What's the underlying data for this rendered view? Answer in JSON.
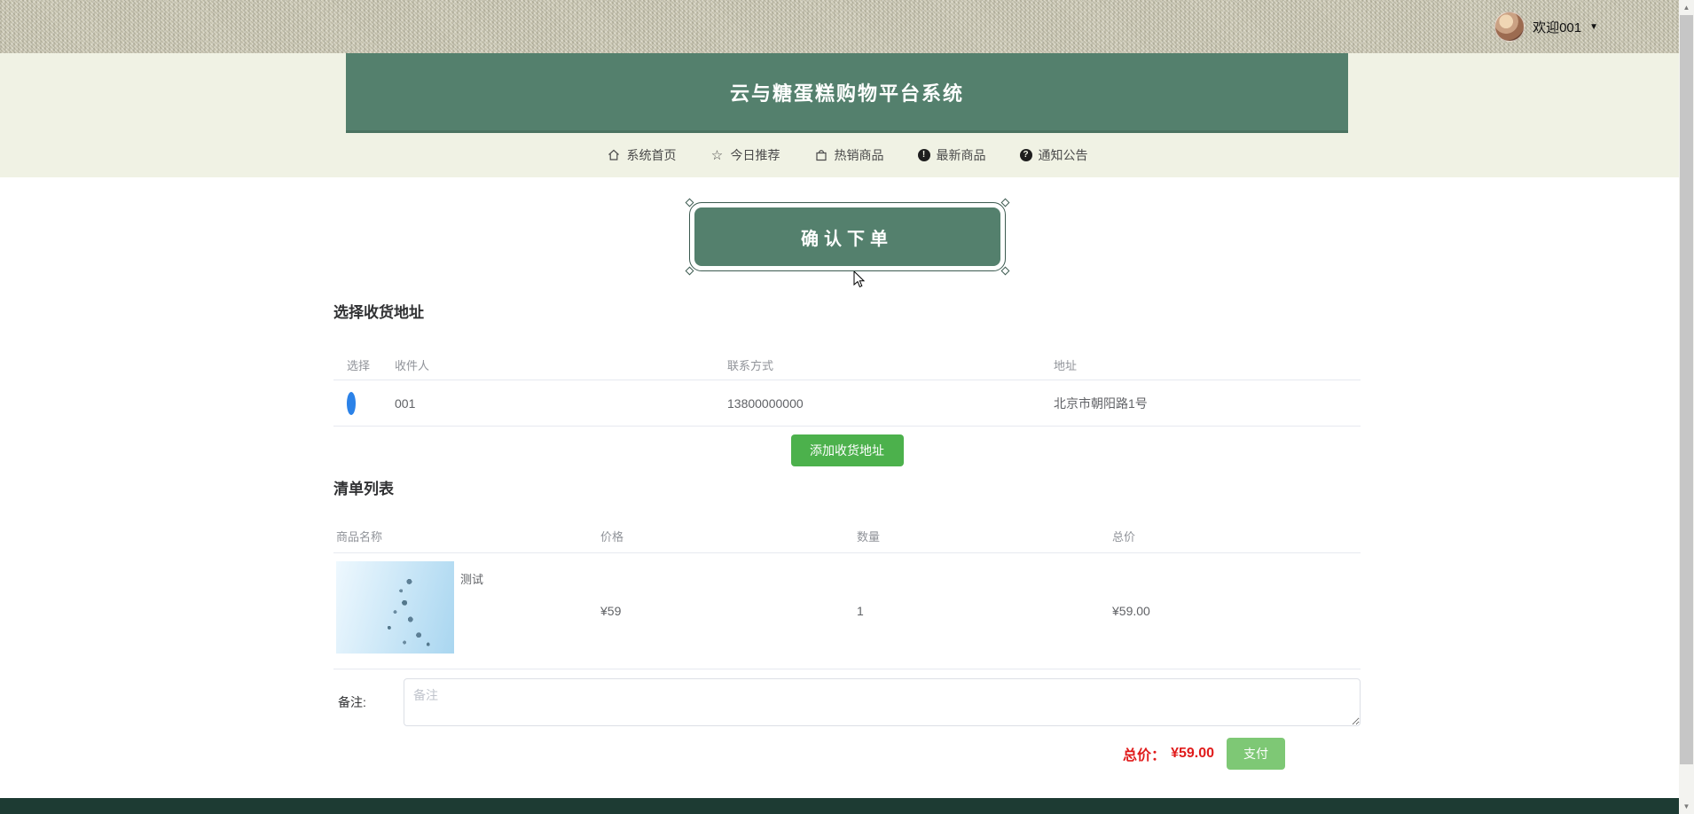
{
  "topbar": {
    "welcome": "欢迎001",
    "caret": "▼"
  },
  "header": {
    "title": "云与糖蛋糕购物平台系统"
  },
  "nav": {
    "items": [
      {
        "icon": "home-icon",
        "label": "系统首页"
      },
      {
        "icon": "star-icon",
        "label": "今日推荐"
      },
      {
        "icon": "bag-icon",
        "label": "热销商品"
      },
      {
        "icon": "info-icon",
        "label": "最新商品"
      },
      {
        "icon": "question-icon",
        "label": "通知公告"
      }
    ],
    "info_glyph": "!",
    "question_glyph": "?",
    "star_glyph": "☆"
  },
  "page": {
    "confirm_title": "确认下单"
  },
  "address_section": {
    "heading": "选择收货地址",
    "table": {
      "headers": [
        "选择",
        "收件人",
        "联系方式",
        "地址"
      ],
      "rows": [
        {
          "selected": true,
          "receiver": "001",
          "phone": "13800000000",
          "address": "北京市朝阳路1号"
        }
      ]
    },
    "add_button": "添加收货地址"
  },
  "cart_section": {
    "heading": "清单列表",
    "table": {
      "headers": [
        "商品名称",
        "价格",
        "数量",
        "总价"
      ],
      "rows": [
        {
          "name": "测试",
          "price": "¥59",
          "qty": "1",
          "total": "¥59.00"
        }
      ]
    }
  },
  "remark": {
    "label": "备注:",
    "placeholder": "备注"
  },
  "checkout": {
    "total_label": "总价：",
    "total_value": "¥59.00",
    "pay_button": "支付"
  },
  "colors": {
    "banner_teal": "#54806d",
    "band_light": "#f0f2e4",
    "footer_dark": "#1d3b33",
    "add_button_green": "#4cb14c",
    "pay_button_green": "#7ec875",
    "total_red": "#e01b1b",
    "radio_blue": "#2b82e8"
  }
}
